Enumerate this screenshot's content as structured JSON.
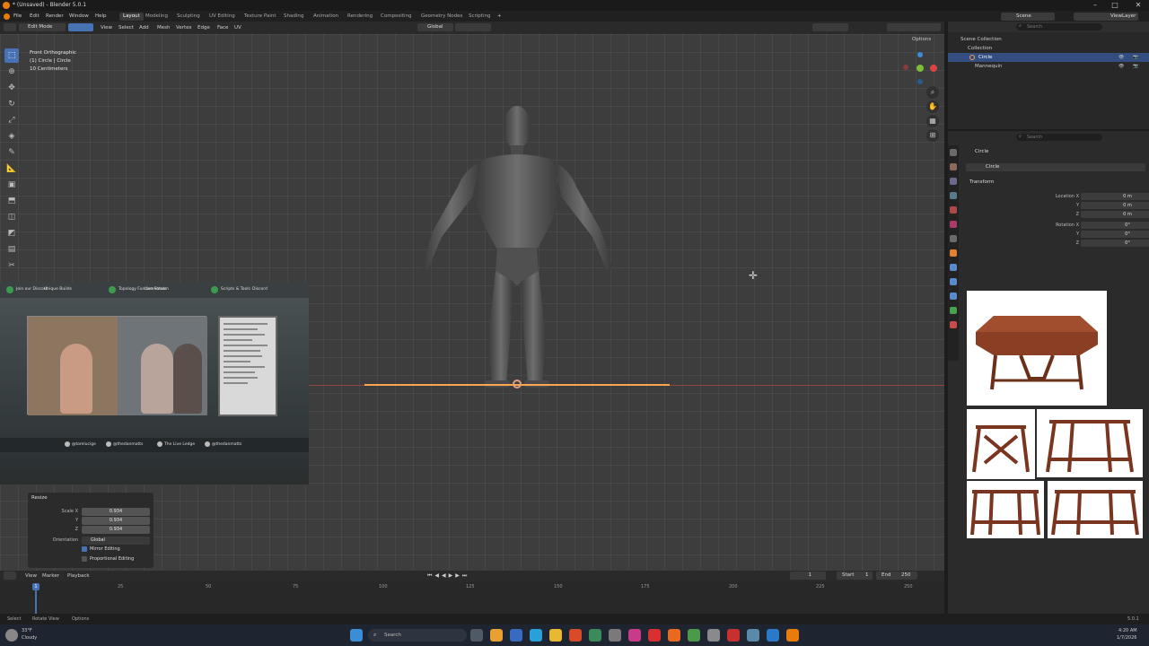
{
  "window": {
    "title": "* (Unsaved) - Blender 5.0.1",
    "controls": [
      "minimize-icon",
      "maximize-icon",
      "close-icon"
    ]
  },
  "menubar": {
    "menus": [
      "File",
      "Edit",
      "Render",
      "Window",
      "Help"
    ],
    "workspaces": [
      "Layout",
      "Modeling",
      "Sculpting",
      "UV Editing",
      "Texture Paint",
      "Shading",
      "Animation",
      "Rendering",
      "Compositing",
      "Geometry Nodes",
      "Scripting"
    ],
    "add_tab": "+",
    "scene": "Scene",
    "view_layer": "ViewLayer"
  },
  "viewport_header": {
    "mode": "Edit Mode",
    "menus": [
      "View",
      "Select",
      "Add",
      "Mesh",
      "Vertex",
      "Edge",
      "Face",
      "UV"
    ],
    "orientation": "Global",
    "options": "Options"
  },
  "viewport": {
    "info": [
      "Front Orthographic",
      "(1) Circle | Circle",
      "10 Centimeters"
    ]
  },
  "webcam": {
    "chips": [
      "Join our Discord",
      "Unique Builds",
      "Topology Fundamentals",
      "Live Stream",
      "Scripts & Tools",
      "Discord"
    ],
    "socials": [
      "@tomlucige",
      "@thedanmatts",
      "The Live Ledge",
      "@thedanmatts"
    ]
  },
  "operator_panel": {
    "title": "Resize",
    "scale_label": "Scale X",
    "y_label": "Y",
    "z_label": "Z",
    "scale_x": "0.934",
    "scale_y": "0.934",
    "scale_z": "0.934",
    "orientation_label": "Orientation",
    "orientation_value": "Global",
    "mirror_editing": "Mirror Editing",
    "proportional_editing": "Proportional Editing"
  },
  "timeline": {
    "menus": [
      "View",
      "Marker",
      "Playback"
    ],
    "current_frame": "1",
    "start_label": "Start",
    "start_value": "1",
    "end_label": "End",
    "end_value": "250",
    "ticks": [
      "1",
      "25",
      "50",
      "75",
      "100",
      "125",
      "150",
      "175",
      "200",
      "225",
      "250"
    ]
  },
  "statusbar": {
    "items": [
      "Select",
      "Rotate View",
      "Options"
    ],
    "version": "5.0.1"
  },
  "outliner": {
    "search_placeholder": "Search",
    "rows": [
      "Scene Collection",
      "Collection",
      "Circle",
      "Mannequin"
    ]
  },
  "properties": {
    "search_placeholder": "Search",
    "object_name": "Circle",
    "data_name": "Circle",
    "section": "Transform",
    "location_label": "Location X",
    "rotation_label": "Rotation X",
    "y_label": "Y",
    "z_label": "Z",
    "loc_x": "0 m",
    "loc_y": "0 m",
    "loc_z": "0 m",
    "rot_x": "0°",
    "rot_y": "0°",
    "rot_z": "0°"
  },
  "taskbar": {
    "weather_temp": "33°F",
    "weather_text": "Cloudy",
    "search_placeholder": "Search",
    "time": "4:20 AM",
    "date": "1/7/2026"
  },
  "colors": {
    "accent": "#4772b3",
    "selection_edge": "#ffa64d",
    "viewport_bg": "#3d3d3d"
  }
}
